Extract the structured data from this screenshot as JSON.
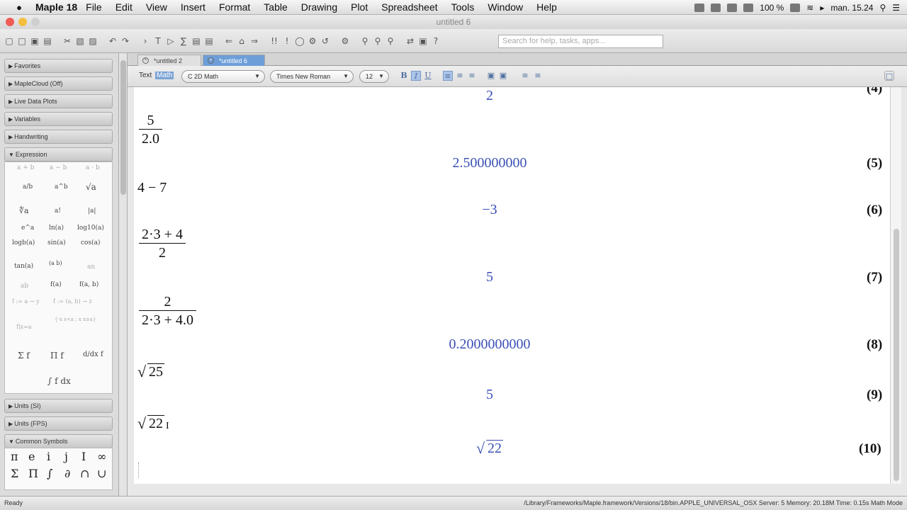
{
  "menubar": {
    "app_name": "Maple 18",
    "items": [
      "File",
      "Edit",
      "View",
      "Insert",
      "Format",
      "Table",
      "Drawing",
      "Plot",
      "Spreadsheet",
      "Tools",
      "Window",
      "Help"
    ],
    "battery": "100 %",
    "clock": "man. 15.24"
  },
  "window": {
    "title": "untitled 6"
  },
  "search": {
    "placeholder": "Search for help, tasks, apps..."
  },
  "palette": {
    "sections": [
      "Favorites",
      "MapleCloud (Off)",
      "Live Data Plots",
      "Variables",
      "Handwriting",
      "Expression",
      "Units (SI)",
      "Units (FPS)",
      "Common Symbols"
    ],
    "expression_items": [
      "a + b",
      "a − b",
      "a · b",
      "a/b",
      "a^b",
      "√a",
      "∜a",
      "a!",
      "|a|",
      "e^a",
      "ln(a)",
      "log10(a)",
      "logb(a)",
      "sin(a)",
      "cos(a)",
      "tan(a)",
      "(a b)",
      "an",
      "ab",
      "f(a)",
      "f(a, b)",
      "f := a → y",
      "f := (a, b) → z",
      "f|x=a",
      "{-x x<a ; x x≥a}",
      "Σ f",
      "Π f",
      "d/dx f",
      "∫ f dx"
    ],
    "common_symbols": [
      "π",
      "e",
      "i",
      "j",
      "I",
      "∞",
      "Σ",
      "Π",
      "∫",
      "∂",
      "∩",
      "∪"
    ]
  },
  "tabs": [
    {
      "label": "*untitled 2",
      "active": false
    },
    {
      "label": "*untitled 6",
      "active": true
    }
  ],
  "format_bar": {
    "text_label": "Text",
    "math_label": "Math",
    "mode": "2D Math",
    "font": "Times New Roman",
    "size": "12",
    "bold": "B",
    "italic": "I",
    "underline": "U"
  },
  "document": {
    "top_output": "2",
    "inputs": {
      "in5_num": "5",
      "in5_den": "2.0",
      "in6": "4 − 7",
      "in7_num": "2·3 + 4",
      "in7_den": "2",
      "in8_num": "2",
      "in8_den": "2·3 + 4.0",
      "in9_radicand": "25",
      "in10_radicand": "22"
    },
    "outputs": {
      "out5": "2.500000000",
      "out6": "−3",
      "out7": "5",
      "out8": "0.2000000000",
      "out9": "5",
      "out10_radicand": "22"
    },
    "labels": {
      "l4": "(4)",
      "l5": "(5)",
      "l6": "(6)",
      "l7": "(7)",
      "l8": "(8)",
      "l9": "(9)",
      "l10": "(10)"
    }
  },
  "status": {
    "left": "Ready",
    "right": "/Library/Frameworks/Maple.framework/Versions/18/bin.APPLE_UNIVERSAL_OSX   Server: 5   Memory: 20.18M   Time: 0.15s   Math Mode"
  }
}
